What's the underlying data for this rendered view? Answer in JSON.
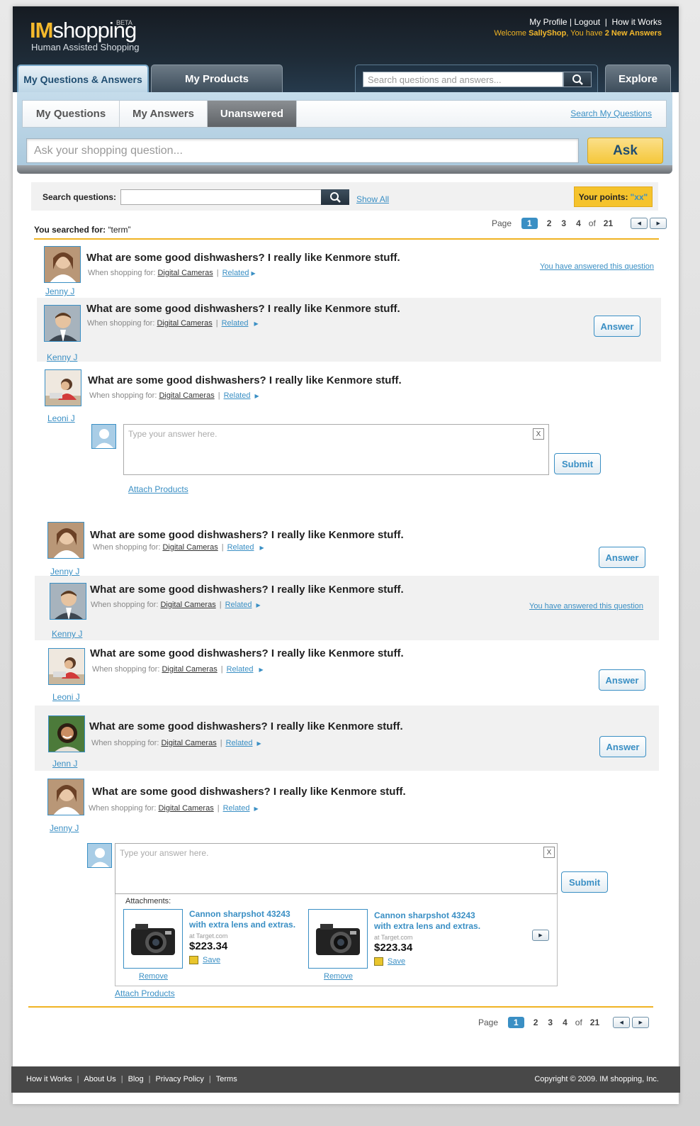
{
  "header": {
    "logo_im": "IM",
    "logo_shopping": "shopping",
    "logo_beta": "BETA",
    "tagline": "Human Assisted Shopping",
    "links": [
      "My Profile",
      "Logout",
      "How it Works"
    ],
    "welcome_prefix": "Welcome ",
    "username": "SallyShop",
    "welcome_mid": ", You have ",
    "new_answers": "2 New Answers"
  },
  "nav": {
    "tab_questions": "My Questions & Answers",
    "tab_products": "My Products",
    "search_placeholder": "Search questions and answers...",
    "explore": "Explore"
  },
  "subtabs": {
    "items": [
      "My Questions",
      "My Answers",
      "Unanswered"
    ],
    "search_mine": "Search My Questions",
    "ask_placeholder": "Ask your shopping question...",
    "ask_button": "Ask"
  },
  "filter": {
    "label": "Search questions:",
    "show_all": "Show All",
    "points_label": "Your points:",
    "points_value": "\"xx\""
  },
  "results": {
    "searched_label": "You searched for:",
    "term": "“term”"
  },
  "pager": {
    "page_label": "Page",
    "current": "1",
    "pages": [
      "2",
      "3",
      "4"
    ],
    "of": "of",
    "total": "21"
  },
  "questions": [
    {
      "name": "Jenny J",
      "title": "What are some good dishwashers? I really like Kenmore stuff.",
      "shopping_for": "When shopping for:",
      "category": "Digital Cameras",
      "related": "Related",
      "status": "You have answered this question"
    },
    {
      "name": "Kenny J",
      "title": "What are some good dishwashers? I really like Kenmore stuff.",
      "shopping_for": "When shopping for:",
      "category": "Digital Cameras",
      "related": "Related",
      "action": "Answer"
    },
    {
      "name": "Leoni J",
      "title": "What are some good dishwashers? I really like Kenmore stuff.",
      "shopping_for": "When shopping for:",
      "category": "Digital Cameras",
      "related": "Related"
    },
    {
      "name": "Jenny J",
      "title": "What are some good dishwashers? I really like Kenmore stuff.",
      "shopping_for": "When shopping for:",
      "category": "Digital Cameras",
      "related": "Related",
      "action": "Answer"
    },
    {
      "name": "Kenny J",
      "title": "What are some good dishwashers? I really like Kenmore stuff.",
      "shopping_for": "When shopping for:",
      "category": "Digital Cameras",
      "related": "Related",
      "status": "You have answered this question"
    },
    {
      "name": "Leoni J",
      "title": "What are some good dishwashers? I really like Kenmore stuff.",
      "shopping_for": "When shopping for:",
      "category": "Digital Cameras",
      "related": "Related",
      "action": "Answer"
    },
    {
      "name": "Jenn J",
      "title": "What are some good dishwashers? I really like Kenmore stuff.",
      "shopping_for": "When shopping for:",
      "category": "Digital Cameras",
      "related": "Related",
      "action": "Answer"
    },
    {
      "name": "Jenny J",
      "title": "What are some good dishwashers? I really like Kenmore stuff.",
      "shopping_for": "When shopping for:",
      "category": "Digital Cameras",
      "related": "Related"
    }
  ],
  "answer_form": {
    "placeholder": "Type your answer here.",
    "close": "X",
    "submit": "Submit",
    "attach": "Attach Products",
    "attachments_label": "Attachments:"
  },
  "products": [
    {
      "title": "Cannon sharpshot 43243 with extra lens and extras.",
      "source": "at Target.com",
      "price": "$223.34",
      "save": "Save",
      "remove": "Remove"
    },
    {
      "title": "Cannon sharpshot 43243 with extra lens and extras.",
      "source": "at Target.com",
      "price": "$223.34",
      "save": "Save",
      "remove": "Remove"
    }
  ],
  "footer": {
    "links": [
      "How it Works",
      "About Us",
      "Blog",
      "Privacy Policy",
      "Terms"
    ],
    "copyright": "Copyright © 2009. IM shopping, Inc."
  },
  "colors": {
    "accent": "#3a8fc4",
    "brand_yellow": "#f5c32c",
    "header_dark": "#1e2b37"
  }
}
